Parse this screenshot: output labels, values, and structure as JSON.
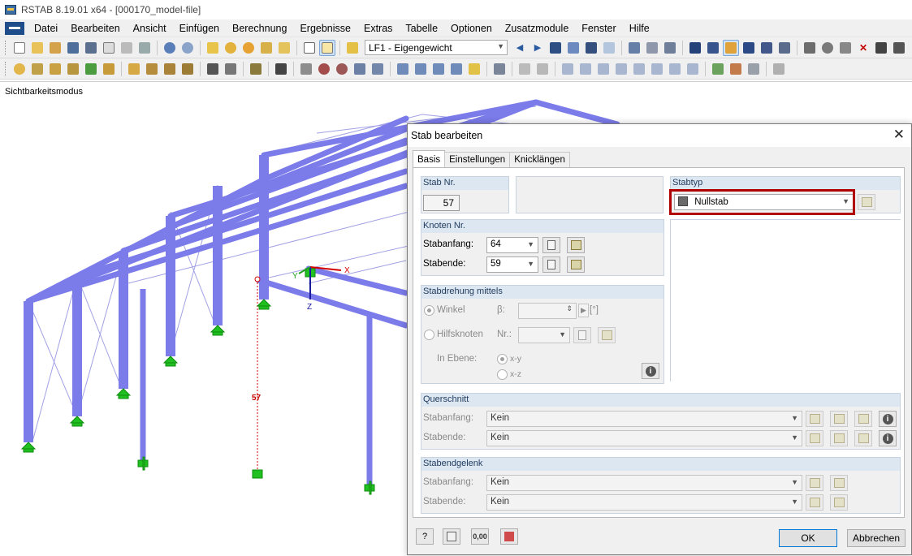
{
  "window": {
    "title": "RSTAB 8.19.01 x64 - [000170_model-file]"
  },
  "menu": [
    "Datei",
    "Bearbeiten",
    "Ansicht",
    "Einfügen",
    "Berechnung",
    "Ergebnisse",
    "Extras",
    "Tabelle",
    "Optionen",
    "Zusatzmodule",
    "Fenster",
    "Hilfe"
  ],
  "toolbar": {
    "loadcase": "LF1 - Eigengewicht"
  },
  "viewport": {
    "mode_label": "Sichtbarkeitsmodus",
    "member_label": "57",
    "axes": {
      "x": "X",
      "y": "Y",
      "z": "Z"
    },
    "colors": {
      "member": "#7b7bea",
      "member_edge": "#4b4bc8",
      "support": "#21c021",
      "null_member": "#d40000"
    }
  },
  "dialog": {
    "title": "Stab bearbeiten",
    "close": "✕",
    "tabs": [
      "Basis",
      "Einstellungen",
      "Knicklängen"
    ],
    "active_tab": "Basis",
    "member": {
      "header": "Stab Nr.",
      "number": "57"
    },
    "type": {
      "header": "Stabtyp",
      "value": "Nullstab",
      "highlight_color": "#b00000"
    },
    "nodes": {
      "header": "Knoten Nr.",
      "start_label": "Stabanfang:",
      "start_value": "64",
      "end_label": "Stabende:",
      "end_value": "59"
    },
    "rotation": {
      "header": "Stabdrehung mittels",
      "angle_label": "Winkel",
      "beta_label": "β:",
      "unit": "[°]",
      "helper_label": "Hilfsknoten",
      "nr_label": "Nr.:",
      "plane_label": "In Ebene:",
      "plane_xy": "x-y",
      "plane_xz": "x-z"
    },
    "section": {
      "header": "Querschnitt",
      "start_label": "Stabanfang:",
      "start_value": "Kein",
      "end_label": "Stabende:",
      "end_value": "Kein"
    },
    "hinge": {
      "header": "Stabendgelenk",
      "start_label": "Stabanfang:",
      "start_value": "Kein",
      "end_label": "Stabende:",
      "end_value": "Kein"
    },
    "buttons": {
      "ok": "OK",
      "cancel": "Abbrechen",
      "units": "0,00"
    }
  }
}
